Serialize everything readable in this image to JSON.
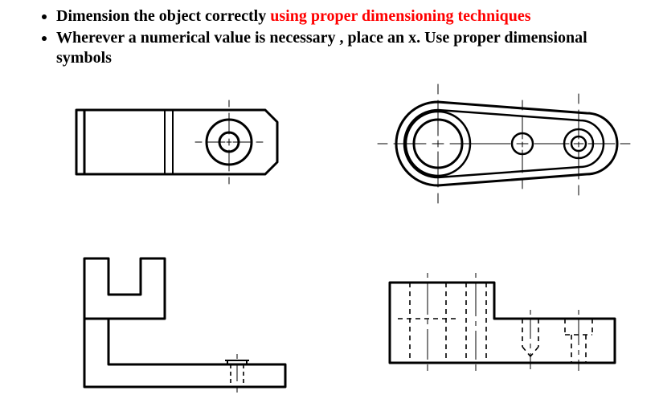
{
  "instructions": {
    "items": [
      {
        "lead": "Dimension the object correctly ",
        "emph": "using proper dimensioning techniques"
      },
      {
        "lead": "Wherever a numerical value is necessary , place an x. Use proper dimensional symbols",
        "emph": ""
      }
    ]
  },
  "figures": {
    "top_left": {
      "desc": "Rectangular plate with vertical grooves, chamfered right end and concentric circles on right half"
    },
    "top_right": {
      "desc": "Obround plate with large left bore and two smaller bores on right, with centerlines"
    },
    "bottom_left": {
      "desc": "L-bracket profile with upper slot and small drilled boss near lower right"
    },
    "bottom_right": {
      "desc": "Stepped block front view with hidden cylindrical and conical features"
    }
  }
}
